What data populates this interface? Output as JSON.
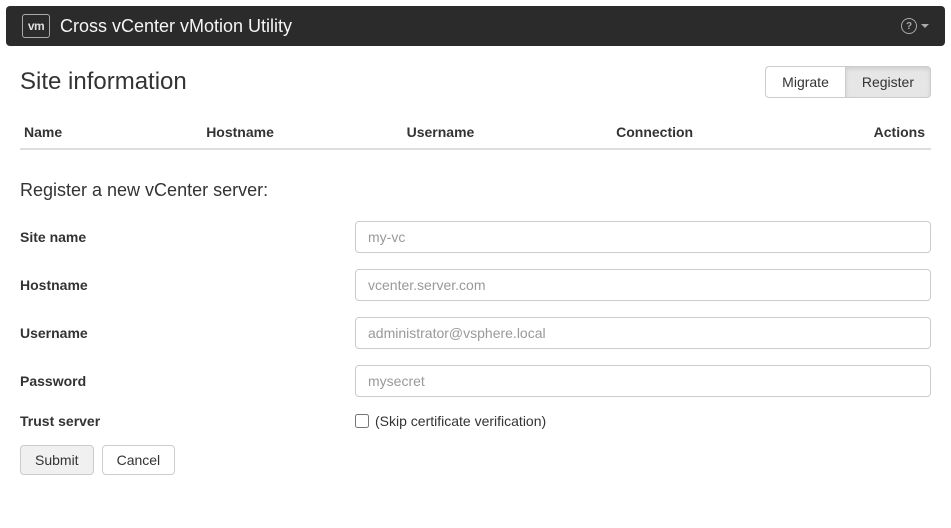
{
  "navbar": {
    "logo_text": "vm",
    "title": "Cross vCenter vMotion Utility"
  },
  "section": {
    "title": "Site information",
    "buttons": {
      "migrate": "Migrate",
      "register": "Register"
    }
  },
  "table": {
    "headers": {
      "name": "Name",
      "hostname": "Hostname",
      "username": "Username",
      "connection": "Connection",
      "actions": "Actions"
    }
  },
  "form": {
    "title": "Register a new vCenter server:",
    "labels": {
      "site_name": "Site name",
      "hostname": "Hostname",
      "username": "Username",
      "password": "Password",
      "trust_server": "Trust server"
    },
    "placeholders": {
      "site_name": "my-vc",
      "hostname": "vcenter.server.com",
      "username": "administrator@vsphere.local",
      "password": "mysecret"
    },
    "checkbox_label": "(Skip certificate verification)",
    "buttons": {
      "submit": "Submit",
      "cancel": "Cancel"
    }
  }
}
